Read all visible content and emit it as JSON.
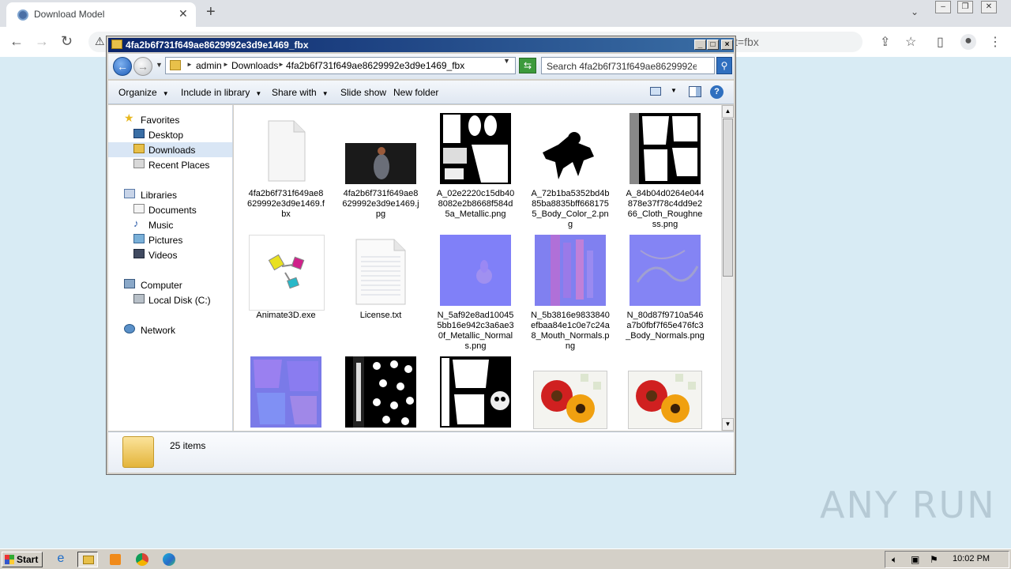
{
  "browser": {
    "tab_title": "Download Model",
    "tab_close": "✕",
    "new_tab": "+",
    "omnibox_tail": "t=fbx"
  },
  "window": {
    "title": "4fa2b6f731f649ae8629992e3d9e1469_fbx",
    "breadcrumb": [
      "admin",
      "Downloads",
      "4fa2b6f731f649ae8629992e3d9e1469_fbx"
    ],
    "search_placeholder": "Search 4fa2b6f731f649ae8629992e3d..."
  },
  "toolbar": {
    "organize": "Organize",
    "include_in_library": "Include in library",
    "share_with": "Share with",
    "slide_show": "Slide show",
    "new_folder": "New folder",
    "help": "?"
  },
  "nav": {
    "favorites": "Favorites",
    "desktop": "Desktop",
    "downloads": "Downloads",
    "recent_places": "Recent Places",
    "libraries": "Libraries",
    "documents": "Documents",
    "music": "Music",
    "pictures": "Pictures",
    "videos": "Videos",
    "computer": "Computer",
    "local_disk": "Local Disk (C:)",
    "network": "Network"
  },
  "files": [
    {
      "name": "4fa2b6f731f649ae8629992e3d9e1469.fbx",
      "icon": "blank-file-icon"
    },
    {
      "name": "4fa2b6f731f649ae8629992e3d9e1469.jpg",
      "icon": "photo-thumbnail"
    },
    {
      "name": "A_02e2220c15db408082e2b8668f584d5a_Metallic.png",
      "icon": "texture-bw-thumbnail"
    },
    {
      "name": "A_72b1ba5352bd4b85ba8835bff6681755_Body_Color_2.png",
      "icon": "texture-silhouette-thumbnail"
    },
    {
      "name": "A_84b04d0264e044878e37f78c4dd9e266_Cloth_Roughness.png",
      "icon": "texture-bw-thumbnail"
    },
    {
      "name": "Animate3D.exe",
      "icon": "exe-icon"
    },
    {
      "name": "License.txt",
      "icon": "text-file-icon"
    },
    {
      "name": "N_5af92e8ad100455bb16e942c3a6ae30f_Metallic_Normals.png",
      "icon": "normal-map-thumbnail"
    },
    {
      "name": "N_5b3816e9833840efbaa84e1c0e7c24a8_Mouth_Normals.png",
      "icon": "normal-map-thumbnail"
    },
    {
      "name": "N_80d87f9710a546a7b0fbf7f65e476fc3_Body_Normals.png",
      "icon": "normal-map-thumbnail"
    },
    {
      "name": "",
      "icon": "normal-map-thumbnail"
    },
    {
      "name": "",
      "icon": "texture-dots-thumbnail"
    },
    {
      "name": "",
      "icon": "texture-bw-thumbnail"
    },
    {
      "name": "",
      "icon": "flower-thumbnail"
    },
    {
      "name": "",
      "icon": "flower-thumbnail"
    }
  ],
  "status": {
    "count": "25 items"
  },
  "taskbar": {
    "start": "Start",
    "clock": "10:02 PM"
  },
  "watermark": "ANY RUN"
}
